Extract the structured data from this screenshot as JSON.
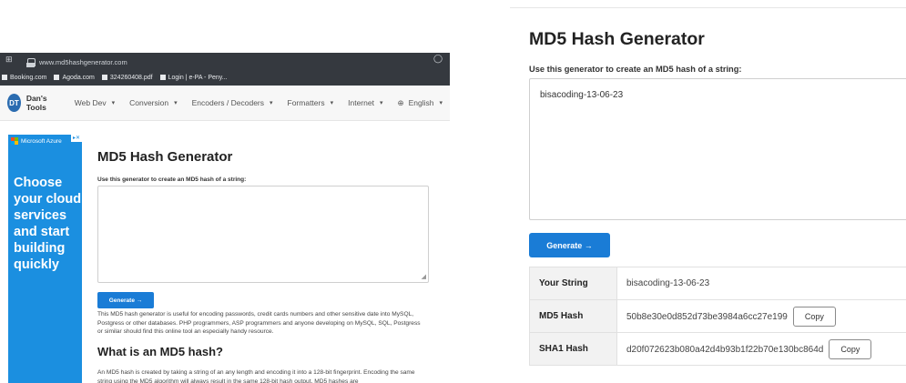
{
  "left": {
    "browser": {
      "url": "www.md5hashgenerator.com",
      "bookmarks": [
        "Booking.com",
        "Agoda.com",
        "324260408.pdf",
        "Login | e-PA - Peny..."
      ]
    },
    "navbar": {
      "brand_logo": "DT",
      "brand_name": "Dan's Tools",
      "items": [
        {
          "label": "Web Dev",
          "caret": "▾"
        },
        {
          "label": "Conversion",
          "caret": "▾"
        },
        {
          "label": "Encoders / Decoders",
          "caret": "▾"
        },
        {
          "label": "Formatters",
          "caret": "▾"
        },
        {
          "label": "Internet",
          "caret": "▾"
        },
        {
          "label": "English",
          "caret": "▾"
        }
      ],
      "language_icon": "globe-icon"
    },
    "ad": {
      "brand": "Microsoft Azure",
      "headline": "Choose your cloud services and start building quickly"
    },
    "title": "MD5 Hash Generator",
    "instruction": "Use this generator to create an MD5 hash of a string:",
    "input_value": "",
    "generate_label": "Generate →",
    "description": "This MD5 hash generator is useful for encoding passwords, credit cards numbers and other sensitive date into MySQL, Postgress or other databases. PHP programmers, ASP programmers and anyone developing on MySQL, SQL, Postgress or similar should find this online tool an especially handy resource.",
    "what_heading": "What is an MD5 hash?",
    "what_text": "An MD5 hash is created by taking a string of an any length and encoding it into a 128-bit fingerprint. Encoding the same string using the MD5 algorithm will always result in the same 128-bit hash output. MD5 hashes are"
  },
  "right": {
    "title": "MD5 Hash Generator",
    "instruction": "Use this generator to create an MD5 hash of a string:",
    "input_value": "bisacoding-13-06-23",
    "generate_label": "Generate →",
    "results": [
      {
        "label": "Your String",
        "value": "bisacoding-13-06-23",
        "copy": ""
      },
      {
        "label": "MD5 Hash",
        "value": "50b8e30e0d852d73be3984a6cc27e199",
        "copy": "Copy"
      },
      {
        "label": "SHA1 Hash",
        "value": "d20f072623b080a42d4b93b1f22b70e130bc864d",
        "copy": "Copy"
      }
    ]
  },
  "colors": {
    "accent": "#1a7cd6",
    "ad_background": "#1b8fe0",
    "browser_chrome": "#35393f"
  }
}
